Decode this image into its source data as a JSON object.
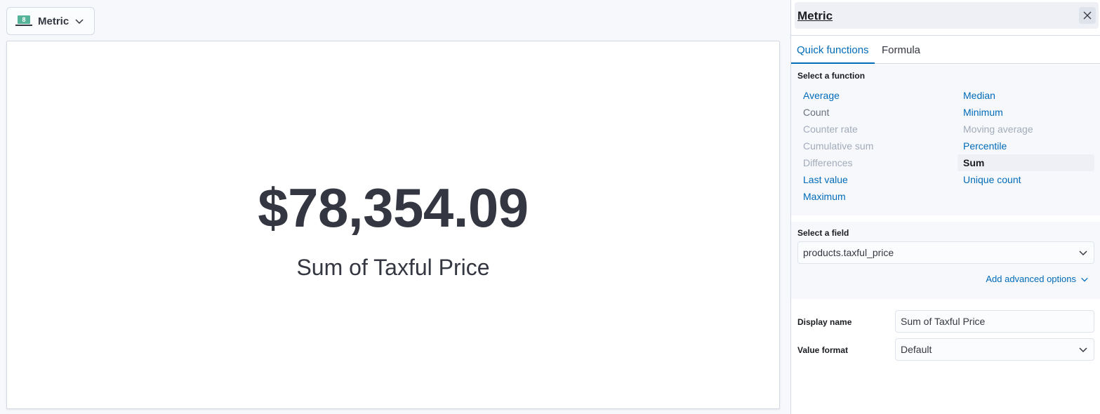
{
  "visualization": {
    "type_label": "Metric",
    "icon_digit": "8",
    "icon": "metric-chart-icon"
  },
  "metric": {
    "value": "$78,354.09",
    "label": "Sum of Taxful Price"
  },
  "flyout": {
    "title": "Metric",
    "close_icon": "close-icon",
    "tabs": [
      {
        "label": "Quick functions",
        "active": true
      },
      {
        "label": "Formula",
        "active": false
      }
    ],
    "select_function_label": "Select a function",
    "functions_left": [
      {
        "label": "Average",
        "state": "link"
      },
      {
        "label": "Count",
        "state": "plain"
      },
      {
        "label": "Counter rate",
        "state": "disabled"
      },
      {
        "label": "Cumulative sum",
        "state": "disabled"
      },
      {
        "label": "Differences",
        "state": "disabled"
      },
      {
        "label": "Last value",
        "state": "link"
      },
      {
        "label": "Maximum",
        "state": "link"
      }
    ],
    "functions_right": [
      {
        "label": "Median",
        "state": "link"
      },
      {
        "label": "Minimum",
        "state": "link"
      },
      {
        "label": "Moving average",
        "state": "disabled"
      },
      {
        "label": "Percentile",
        "state": "link"
      },
      {
        "label": "Sum",
        "state": "selected"
      },
      {
        "label": "Unique count",
        "state": "link"
      }
    ],
    "select_field_label": "Select a field",
    "selected_field": "products.taxful_price",
    "advanced_options_label": "Add advanced options",
    "display_name_label": "Display name",
    "display_name_value": "Sum of Taxful Price",
    "value_format_label": "Value format",
    "value_format_value": "Default"
  },
  "colors": {
    "accent": "#006bb8",
    "metric_icon": "#54b399",
    "text": "#343741",
    "disabled": "#a2abba"
  }
}
